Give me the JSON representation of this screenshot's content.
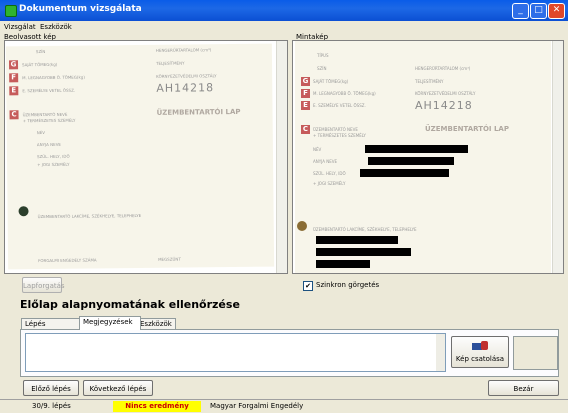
{
  "window": {
    "title": "Dokumentum vizsgálata"
  },
  "menu": {
    "items": [
      "Vizsgálat",
      "Eszközök"
    ]
  },
  "panels": {
    "left_label": "Beolvasott kép",
    "right_label": "Mintakép"
  },
  "left_doc": {
    "header": "ÜZEMBENTARTÓI LAP",
    "serial": "AH14218",
    "fields": [
      "SZÍN",
      "SAJÁT TÖMEG(kg)",
      "M. LEGNAGYOBB Ö. TÖMEG(kg)",
      "E. SZEMÉLYE VETEL ÖSSZ.",
      "ÜZEMBENTARTÓ NEVE",
      "+ TERMÉSZETES SZEMÉLY",
      "NÉV",
      "ANYJA NEVE",
      "SZÜL. HELY, IDŐ",
      "+ JOGI SZEMÉLY",
      "ÜZEMBENTARTÓ LAKCÍME, SZÉKHELYE, TELEPHELYE",
      "FORGALMI ENGEDÉLY SZÁMA"
    ],
    "side_fields": [
      "HENGERŰRTARTALOM (cm³)",
      "TELJESÍTMÉNY",
      "KÖRNYEZETVÉDELMI OSZTÁLY",
      "MEGSZŰNT"
    ],
    "sections": [
      "G",
      "F",
      "E",
      "C"
    ]
  },
  "right_doc": {
    "header": "ÜZEMBENTARTÓI LAP",
    "serial": "AH14218",
    "fields": [
      "TÍPUS",
      "SZÍN",
      "SAJÁT TÖMEG(kg)",
      "M. LEGNAGYOBB Ö. TÖMEG(kg)",
      "E. SZEMÉLYE VETEL ÖSSZ.",
      "ÜZEMBENTARTÓ NEVE",
      "+ TERMÉSZETES SZEMÉLY",
      "NÉV",
      "ANYJA NEVE",
      "SZÜL. HELY, IDŐ",
      "+ JOGI SZEMÉLY",
      "ÜZEMBENTARTÓ LAKCÍME, SZÉKHELYE, TELEPHELYE"
    ],
    "side_fields": [
      "HENGERŰRTARTALOM (cm³)",
      "TELJESÍTMÉNY",
      "KÖRNYEZETVÉDELMI OSZTÁLY"
    ],
    "sections": [
      "G",
      "F",
      "E",
      "C"
    ]
  },
  "controls": {
    "rotate_button": "Lapforgatás",
    "sync_scroll": "Szinkron görgetés",
    "sync_checked": "✔"
  },
  "section_title": "Előlap alapnyomatának ellenőrzése",
  "tabs": [
    "Lépés értékelése",
    "Megjegyzések",
    "Eszközök"
  ],
  "attach_button": "Kép csatolása",
  "nav": {
    "prev": "Előző lépés",
    "next": "Következő lépés",
    "close": "Bezár"
  },
  "status": {
    "step": "30/9. lépés",
    "result": "Nincs eredmény",
    "doc_type": "Magyar Forgalmi Engedély",
    "result_color": "#ffff00"
  }
}
